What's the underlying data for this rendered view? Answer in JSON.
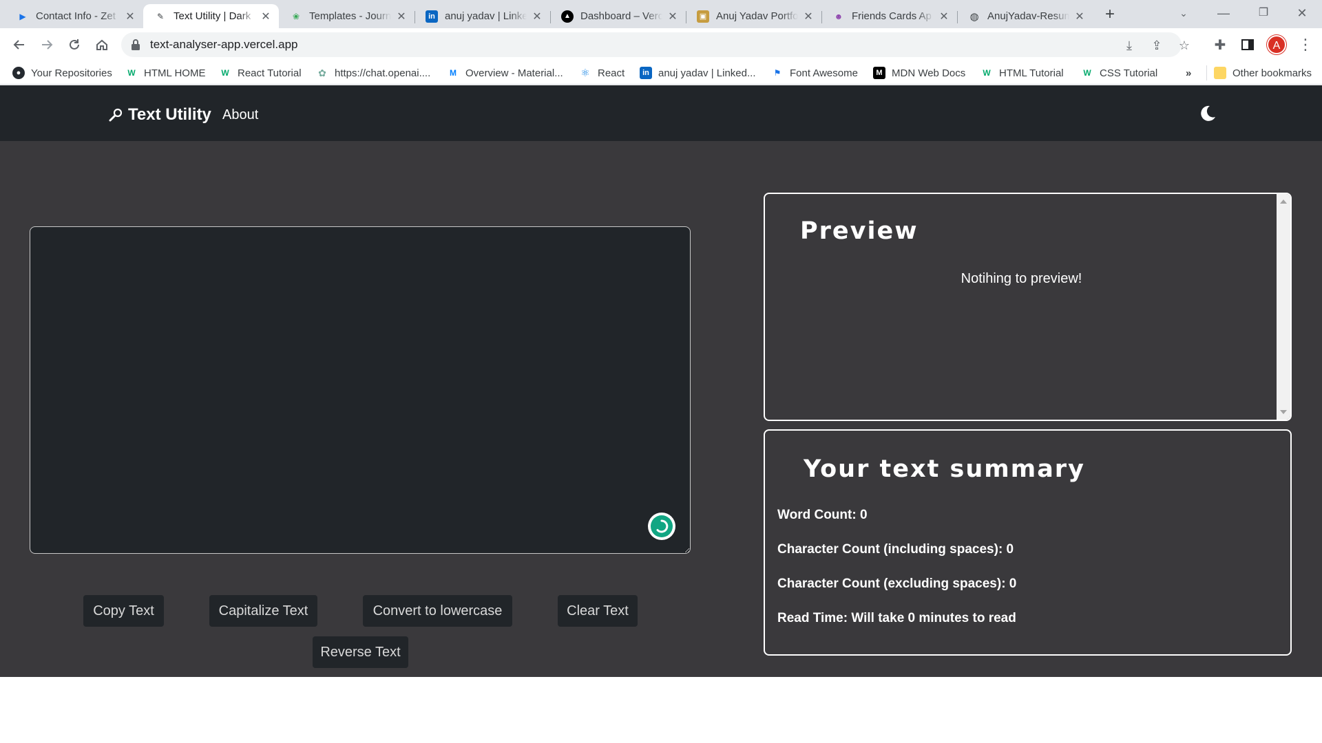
{
  "browser": {
    "tabs": [
      {
        "title": "Contact Info - Zet",
        "icon": "zety-icon",
        "active": false
      },
      {
        "title": "Text Utility | Dark",
        "icon": "app-icon",
        "active": true
      },
      {
        "title": "Templates - Journ",
        "icon": "templates-icon",
        "active": false
      },
      {
        "title": "anuj yadav | Linke",
        "icon": "linkedin-icon",
        "active": false
      },
      {
        "title": "Dashboard – Verc",
        "icon": "vercel-icon",
        "active": false
      },
      {
        "title": "Anuj Yadav Portfo",
        "icon": "portfolio-icon",
        "active": false
      },
      {
        "title": "Friends Cards Ap",
        "icon": "friends-icon",
        "active": false
      },
      {
        "title": "AnujYadav-Resum",
        "icon": "globe-icon",
        "active": false
      }
    ],
    "url": "text-analyser-app.vercel.app",
    "profile_initial": "A",
    "bookmarks": [
      {
        "label": "Your Repositories",
        "icon": "github-icon"
      },
      {
        "label": "HTML HOME",
        "icon": "w3schools-icon"
      },
      {
        "label": "React Tutorial",
        "icon": "w3schools-icon"
      },
      {
        "label": "https://chat.openai....",
        "icon": "openai-icon"
      },
      {
        "label": "Overview - Material...",
        "icon": "mui-icon"
      },
      {
        "label": "React",
        "icon": "react-icon"
      },
      {
        "label": "anuj yadav | Linked...",
        "icon": "linkedin-icon"
      },
      {
        "label": "Font Awesome",
        "icon": "fontawesome-icon"
      },
      {
        "label": "MDN Web Docs",
        "icon": "mdn-icon"
      },
      {
        "label": "HTML Tutorial",
        "icon": "w3schools-icon"
      },
      {
        "label": "CSS Tutorial",
        "icon": "w3schools-icon"
      }
    ],
    "bookmarks_overflow": "»",
    "other_bookmarks": "Other bookmarks"
  },
  "app": {
    "brand": "Text Utility",
    "nav_about": "About",
    "textarea_value": "",
    "buttons": {
      "copy": "Copy Text",
      "capitalize": "Capitalize Text",
      "lowercase": "Convert to lowercase",
      "clear": "Clear Text",
      "reverse": "Reverse Text"
    },
    "preview": {
      "title": "Preview",
      "empty_message": "Notihing to preview!"
    },
    "summary": {
      "title": "Your text summary",
      "word_count": "Word Count: 0",
      "char_with_spaces": "Character Count (including spaces): 0",
      "char_without_spaces": "Character Count (excluding spaces): 0",
      "read_time": "Read Time: Will take 0 minutes to read"
    }
  },
  "colors": {
    "navbar": "#212529",
    "page_bg": "#3a393c",
    "editor_bg": "#212529",
    "button_bg": "#212529",
    "grammar_badge": "#11a683"
  }
}
